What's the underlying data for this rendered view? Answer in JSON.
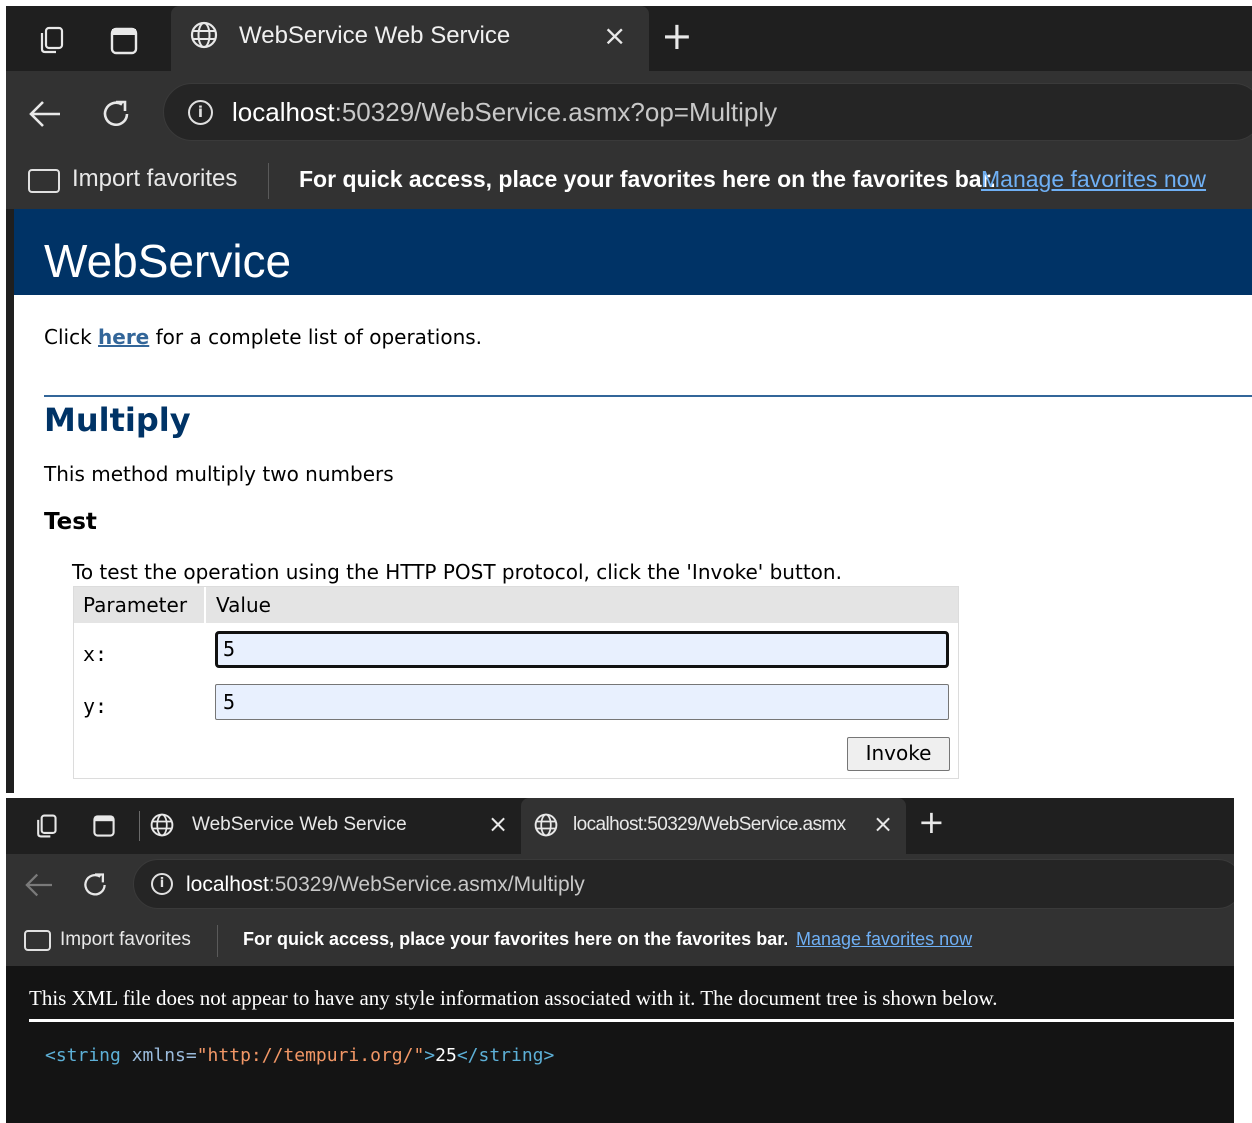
{
  "window1": {
    "tab": {
      "title": "WebService Web Service",
      "close_glyph": "×",
      "new_tab_glyph": "+"
    },
    "address": {
      "host": "localhost",
      "rest": ":50329/WebService.asmx?op=Multiply"
    },
    "favorites_bar": {
      "import_label": "Import favorites",
      "message": "For quick access, place your favorites here on the favorites bar.",
      "manage_link": "Manage favorites now"
    },
    "page": {
      "banner_title": "WebService",
      "click_prefix": "Click ",
      "here_link": "here",
      "click_suffix": " for a complete list of operations.",
      "operation_title": "Multiply",
      "operation_description": "This method multiply two numbers",
      "test_heading": "Test",
      "test_instructions": "To test the operation using the HTTP POST protocol, click the 'Invoke' button.",
      "table": {
        "col_parameter": "Parameter",
        "col_value": "Value",
        "rows": [
          {
            "label": "x:",
            "value": "5"
          },
          {
            "label": "y:",
            "value": "5"
          }
        ]
      },
      "invoke_label": "Invoke"
    }
  },
  "window2": {
    "tabs": [
      {
        "title": "WebService Web Service",
        "close_glyph": "×"
      },
      {
        "title": "localhost:50329/WebService.asmx",
        "close_glyph": "×"
      }
    ],
    "new_tab_glyph": "+",
    "address": {
      "host": "localhost",
      "rest": ":50329/WebService.asmx/Multiply"
    },
    "favorites_bar": {
      "import_label": "Import favorites",
      "message": "For quick access, place your favorites here on the favorites bar.",
      "manage_link": "Manage favorites now"
    },
    "page": {
      "xml_notice": "This XML file does not appear to have any style information associated with it. The document tree is shown below.",
      "xml": {
        "open_tag": "<string",
        "attr_name": " xmlns=",
        "attr_value": "\"http://tempuri.org/\"",
        "open_close": ">",
        "text": "25",
        "close_tag": "</string>"
      }
    }
  },
  "icons": [
    "workspaces-icon",
    "tab-actions-icon",
    "globe-icon",
    "back-arrow-icon",
    "refresh-icon",
    "site-info-icon",
    "import-favorites-icon"
  ],
  "colors": {
    "banner": "#003366",
    "heading": "#003366",
    "link": "#336699",
    "input_fill": "#e8f0fe",
    "xml_tag": "#5db0d7",
    "xml_value": "#f29766"
  }
}
